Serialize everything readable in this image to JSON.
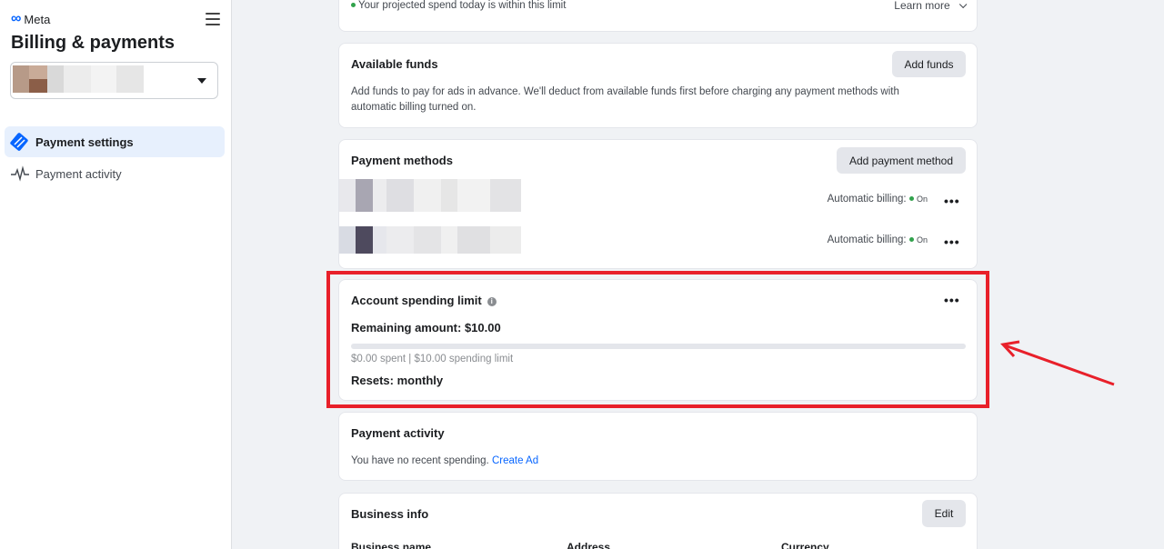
{
  "sidebar": {
    "brand": "Meta",
    "title": "Billing & payments",
    "nav": [
      {
        "label": "Payment settings",
        "icon": "payment-card-icon",
        "active": true
      },
      {
        "label": "Payment activity",
        "icon": "activity-pulse-icon",
        "active": false
      }
    ]
  },
  "top_strip": {
    "notice": "Your projected spend today is within this limit",
    "learn_more": "Learn more"
  },
  "available_funds": {
    "title": "Available funds",
    "button": "Add funds",
    "description": "Add funds to pay for ads in advance. We'll deduct from available funds first before charging any payment methods with automatic billing turned on."
  },
  "payment_methods": {
    "title": "Payment methods",
    "button": "Add payment method",
    "rows": [
      {
        "billing_label": "Automatic billing:",
        "status": "On"
      },
      {
        "billing_label": "Automatic billing:",
        "status": "On"
      }
    ]
  },
  "spending_limit": {
    "title": "Account spending limit",
    "remaining": "Remaining amount: $10.00",
    "summary": "$0.00 spent | $10.00 spending limit",
    "progress_fraction": 0.0,
    "resets": "Resets: monthly"
  },
  "payment_activity": {
    "title": "Payment activity",
    "message": "You have no recent spending.",
    "link": "Create Ad"
  },
  "business_info": {
    "title": "Business info",
    "button": "Edit",
    "columns": [
      "Business name",
      "Address",
      "Currency"
    ]
  },
  "colors": {
    "accent": "#0866ff",
    "highlight": "#e8202a",
    "status_on": "#31a24c"
  }
}
